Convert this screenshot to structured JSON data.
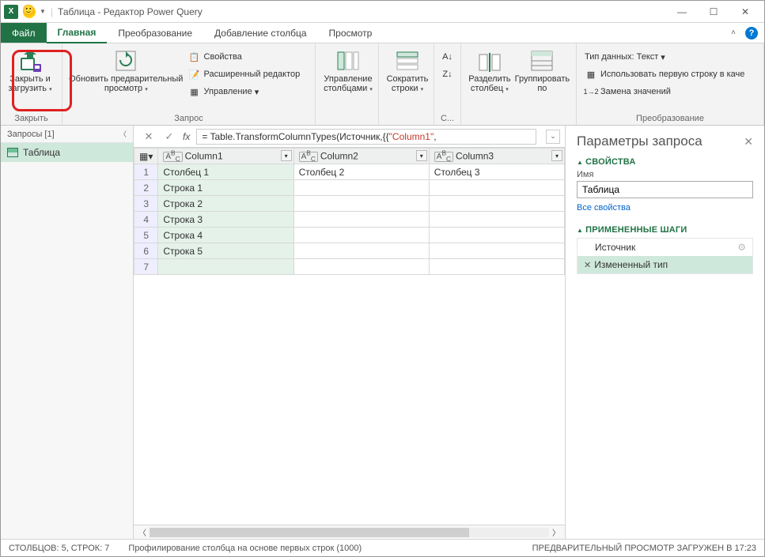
{
  "titlebar": {
    "title": "Таблица - Редактор Power Query"
  },
  "tabs": {
    "file": "Файл",
    "home": "Главная",
    "transform": "Преобразование",
    "addcol": "Добавление столбца",
    "view": "Просмотр"
  },
  "ribbon": {
    "close_load": "Закрыть и загрузить",
    "group_close": "Закрыть",
    "refresh": "Обновить предварительный просмотр",
    "props": "Свойства",
    "adv_editor": "Расширенный редактор",
    "manage": "Управление",
    "group_query": "Запрос",
    "manage_cols": "Управление столбцами",
    "reduce_rows": "Сократить строки",
    "group_s": "С...",
    "split_col": "Разделить столбец",
    "group_by": "Группировать по",
    "data_type": "Тип данных: Текст",
    "first_row": "Использовать первую строку в каче",
    "replace": "Замена значений",
    "group_transform": "Преобразование"
  },
  "queries": {
    "header": "Запросы [1]",
    "item1": "Таблица"
  },
  "formula": {
    "prefix": "= Table.TransformColumnTypes(Источник,{{",
    "q": "\"Column1\"",
    "suffix": ","
  },
  "columns": {
    "c1": "Column1",
    "c2": "Column2",
    "c3": "Column3"
  },
  "rows": [
    {
      "n": "1",
      "a": "Столбец 1",
      "b": "Столбец 2",
      "c": "Столбец 3"
    },
    {
      "n": "2",
      "a": "Строка 1",
      "b": "",
      "c": ""
    },
    {
      "n": "3",
      "a": "Строка 2",
      "b": "",
      "c": ""
    },
    {
      "n": "4",
      "a": "Строка 3",
      "b": "",
      "c": ""
    },
    {
      "n": "5",
      "a": "Строка 4",
      "b": "",
      "c": ""
    },
    {
      "n": "6",
      "a": "Строка 5",
      "b": "",
      "c": ""
    },
    {
      "n": "7",
      "a": "",
      "b": "",
      "c": ""
    }
  ],
  "params": {
    "title": "Параметры запроса",
    "props_hd": "СВОЙСТВА",
    "name_lbl": "Имя",
    "name_val": "Таблица",
    "all_props": "Все свойства",
    "steps_hd": "ПРИМЕНЕННЫЕ ШАГИ",
    "step1": "Источник",
    "step2": "Измененный тип"
  },
  "status": {
    "left": "СТОЛБЦОВ: 5, СТРОК: 7",
    "mid": "Профилирование столбца на основе первых строк (1000)",
    "right": "ПРЕДВАРИТЕЛЬНЫЙ ПРОСМОТР ЗАГРУЖЕН В 17:23"
  }
}
